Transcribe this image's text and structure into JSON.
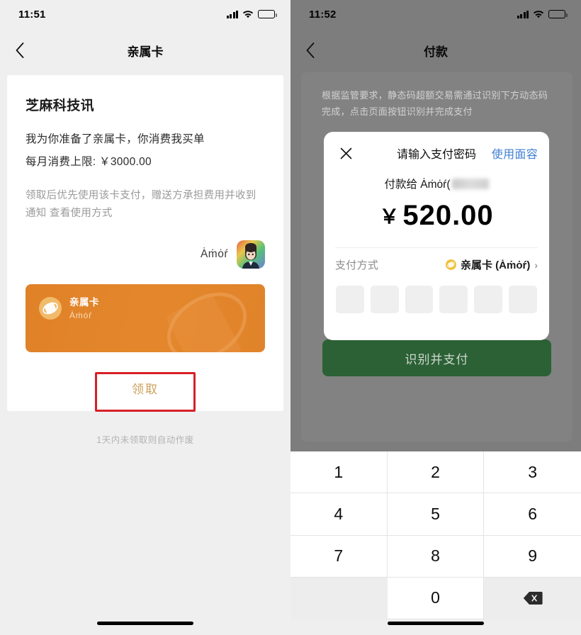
{
  "left": {
    "statusbar": {
      "time": "11:51",
      "signal_icon": "cellular-signal-icon",
      "wifi_icon": "wifi-icon",
      "battery_icon": "battery-icon"
    },
    "nav": {
      "back_icon": "chevron-left-icon",
      "title": "亲属卡"
    },
    "card": {
      "brand": "芝麻科技讯",
      "line1": "我为你准备了亲属卡，你消费我买单",
      "line2": "每月消费上限: ￥3000.00",
      "note": "领取后优先使用该卡支付，赠送方承担费用并收到通知 查看使用方式",
      "signer_name": "Ȧṁȯŕ",
      "avatar_icon": "user-avatar",
      "orange_card": {
        "badge_icon": "family-card-icon",
        "title": "亲属卡",
        "subtitle": "Ȧṁȯŕ",
        "deco_icon": "card-orbit-decoration"
      },
      "claim_label": "领取"
    },
    "footer_note": "1天内未领取则自动作废",
    "annotation_color": "#d81f26",
    "home_indicator": "home-indicator"
  },
  "right": {
    "statusbar": {
      "time": "11:52",
      "signal_icon": "cellular-signal-icon",
      "wifi_icon": "wifi-icon",
      "battery_icon": "battery-icon"
    },
    "nav": {
      "back_icon": "chevron-left-icon",
      "title": "付款"
    },
    "notice": "根据监管要求，静态码超额交易需通过识别下方动态码完成，点击页面按钮识别并完成支付",
    "confirm_button": "识别并支付",
    "dialog": {
      "close_icon": "close-icon",
      "title": "请输入支付密码",
      "faceid_label": "使用面容",
      "faceid_color": "#3f7fd4",
      "pay_to_prefix": "付款给 Ȧṁȯŕ(",
      "currency": "￥",
      "amount": "520.00",
      "method_label": "支付方式",
      "method_value": "亲属卡 (Ȧṁȯŕ)",
      "method_icon": "family-card-dot-icon",
      "method_chevron_icon": "chevron-right-icon",
      "pin_boxes": 6
    },
    "keypad": {
      "keys": [
        "1",
        "2",
        "3",
        "4",
        "5",
        "6",
        "7",
        "8",
        "9",
        "",
        "0",
        "backspace-icon"
      ]
    },
    "annotation_color": "#d81f26",
    "home_indicator": "home-indicator"
  }
}
